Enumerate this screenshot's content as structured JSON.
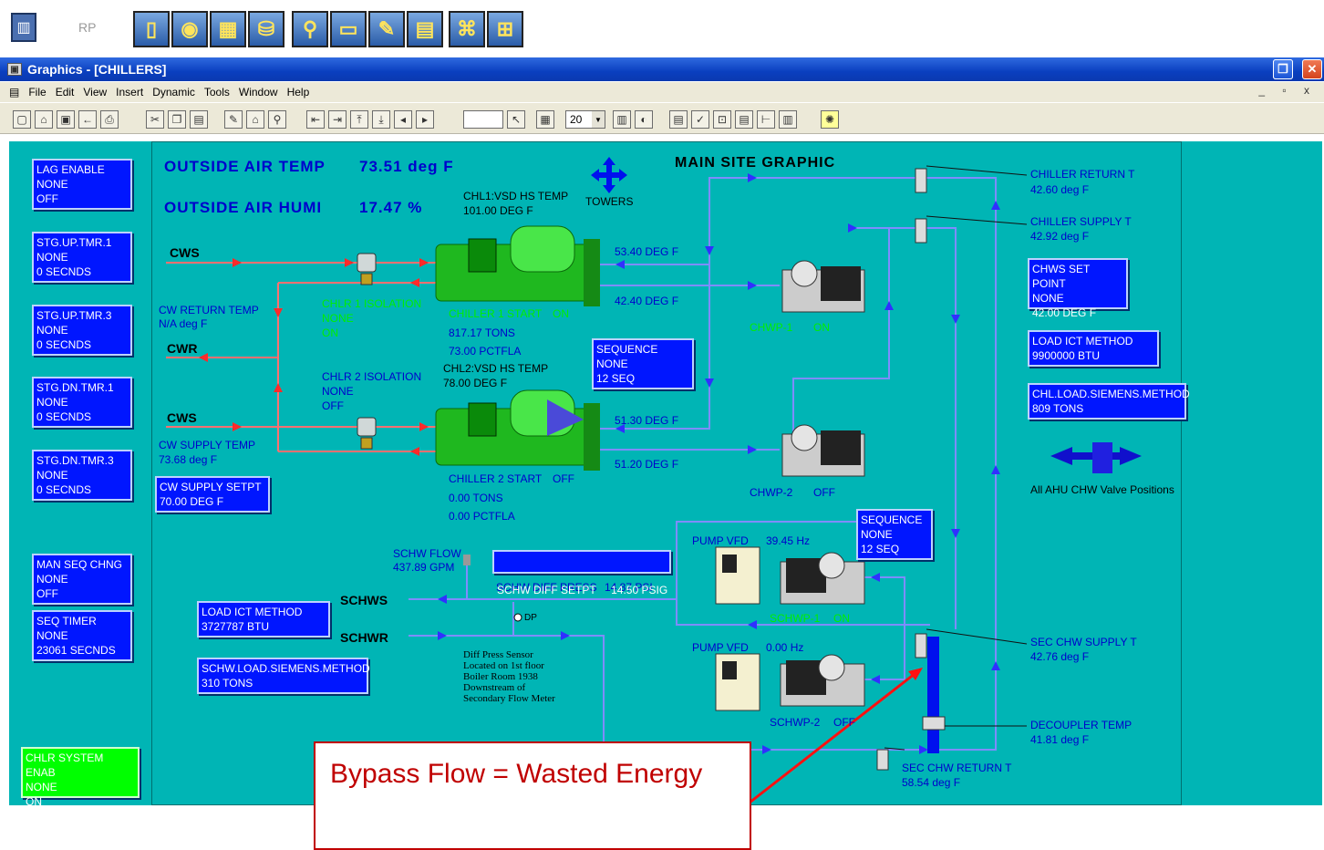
{
  "launcher": {
    "rp_label": "RP",
    "buttons": [
      "door-icon",
      "globe-icon",
      "building-icon",
      "database-search-icon",
      "magnifier-icon",
      "window-icon",
      "edit-doc-icon",
      "calendar-icon",
      "org-chart-icon",
      "network-icon"
    ]
  },
  "window": {
    "title": "Graphics - [CHILLERS]",
    "menu": [
      "File",
      "Edit",
      "View",
      "Insert",
      "Dynamic",
      "Tools",
      "Window",
      "Help"
    ],
    "zoom": "20"
  },
  "graphic": {
    "title": "MAIN SITE GRAPHIC",
    "outside_air_temp_label": "OUTSIDE AIR TEMP",
    "outside_air_temp_value": "73.51 deg F",
    "outside_air_humi_label": "OUTSIDE AIR HUMI",
    "outside_air_humi_value": "17.47 %",
    "towers_label": "TOWERS",
    "chl1_hs_temp_label": "CHL1:VSD HS TEMP",
    "chl1_hs_temp_value": "101.00 DEG F",
    "chl2_hs_temp_label": "CHL2:VSD HS TEMP",
    "chl2_hs_temp_value": "78.00 DEG F",
    "cws1": "CWS",
    "cwr": "CWR",
    "cws2": "CWS",
    "cw_return_temp_label": "CW RETURN TEMP",
    "cw_return_temp_value": "N/A deg F",
    "cw_supply_temp_label": "CW SUPPLY TEMP",
    "cw_supply_temp_value": "73.68 deg F",
    "chlr1_isolation": [
      "CHLR 1 ISOLATION",
      "NONE",
      "ON"
    ],
    "chlr2_isolation": [
      "CHLR 2 ISOLATION",
      "NONE",
      "OFF"
    ],
    "chiller1_start": "CHILLER 1 START",
    "chiller1_start_state": "ON",
    "chiller1_tons": "817.17 TONS",
    "chiller1_pctfla": "73.00 PCTFLA",
    "chiller2_start": "CHILLER 2 START",
    "chiller2_start_state": "OFF",
    "chiller2_tons": "0.00 TONS",
    "chiller2_pctfla": "0.00 PCTFLA",
    "temp_53": "53.40 DEG F",
    "temp_42": "42.40 DEG F",
    "temp_51_30": "51.30 DEG F",
    "temp_51_20": "51.20 DEG F",
    "chwp1": "CHWP-1",
    "chwp1_state": "ON",
    "chwp2": "CHWP-2",
    "chwp2_state": "OFF",
    "chiller_return_t_label": "CHILLER RETURN T",
    "chiller_return_t_value": "42.60 deg F",
    "chiller_supply_t_label": "CHILLER SUPPLY T",
    "chiller_supply_t_value": "42.92 deg F",
    "all_ahu": "All AHU CHW Valve Positions",
    "schw_flow_label": "SCHW FLOW",
    "schw_flow_value": "437.89 GPM",
    "schw_diff_press_label": "SCHW DIFF PRESS",
    "schw_diff_press_value": "14.87 PSI",
    "schws": "SCHWS",
    "schwr": "SCHWR",
    "dp": "DP",
    "diff_press_note": [
      "Diff Press Sensor",
      "Located on 1st floor",
      "Boiler Room 1938",
      "Downstream of",
      "Secondary Flow Meter"
    ],
    "pump_vfd1_label": "PUMP VFD",
    "pump_vfd1_value": "39.45 Hz",
    "pump_vfd2_label": "PUMP VFD",
    "pump_vfd2_value": "0.00 Hz",
    "schwp1": "SCHWP-1",
    "schwp1_state": "ON",
    "schwp2": "SCHWP-2",
    "schwp2_state": "OFF",
    "sec_chw_supply_label": "SEC CHW SUPPLY T",
    "sec_chw_supply_value": "42.76 deg F",
    "decoupler_label": "DECOUPLER TEMP",
    "decoupler_value": "41.81 deg F",
    "sec_chw_return_label": "SEC CHW RETURN T",
    "sec_chw_return_value": "58.54 deg F"
  },
  "boxes": {
    "lag_enable": [
      "LAG ENABLE",
      "NONE",
      "OFF"
    ],
    "stg_up_tmr1": [
      "STG.UP.TMR.1",
      "NONE",
      "0 SECNDS"
    ],
    "stg_up_tmr3": [
      "STG.UP.TMR.3",
      "NONE",
      "0 SECNDS"
    ],
    "stg_dn_tmr1": [
      "STG.DN.TMR.1",
      "NONE",
      "0 SECNDS"
    ],
    "stg_dn_tmr3": [
      "STG.DN.TMR.3",
      "NONE",
      "0 SECNDS"
    ],
    "cw_supply_setpt": [
      "CW SUPPLY SETPT",
      "70.00 DEG F"
    ],
    "sequence1": [
      "SEQUENCE",
      "NONE",
      "12 SEQ"
    ],
    "sequence2": [
      "SEQUENCE",
      "NONE",
      "12 SEQ"
    ],
    "man_seq_chng": [
      "MAN SEQ CHNG",
      "NONE",
      "OFF"
    ],
    "seq_timer": [
      "SEQ TIMER",
      "NONE",
      "23061 SECNDS"
    ],
    "load_ict_left": [
      "LOAD ICT METHOD",
      "3727787 BTU"
    ],
    "schw_load_siemens": [
      "SCHW.LOAD.SIEMENS.METHOD",
      "310 TONS"
    ],
    "chlr_system_enab": [
      "CHLR SYSTEM ENAB",
      "NONE",
      "ON"
    ],
    "schw_diff_setpt": [
      "SCHW DIFF SETPT     14.50 PSIG"
    ],
    "chws_set_point": [
      "CHWS SET POINT",
      "NONE",
      "42.00 DEG F"
    ],
    "load_ict_right": [
      "LOAD ICT METHOD",
      "9900000 BTU"
    ],
    "chl_load_siemens": [
      "CHL.LOAD.SIEMENS.METHOD",
      "809 TONS"
    ]
  },
  "callout": {
    "text": "Bypass Flow = Wasted Energy",
    "border_color": "#c00000"
  },
  "colors": {
    "background": "#00b5b5",
    "box_fill": "#0016ff",
    "title_bar": "#0a3fbf",
    "chiller_green": "#2fd12f",
    "pipe_red": "#ff2a2a",
    "pipe_blue": "#2020ff"
  }
}
